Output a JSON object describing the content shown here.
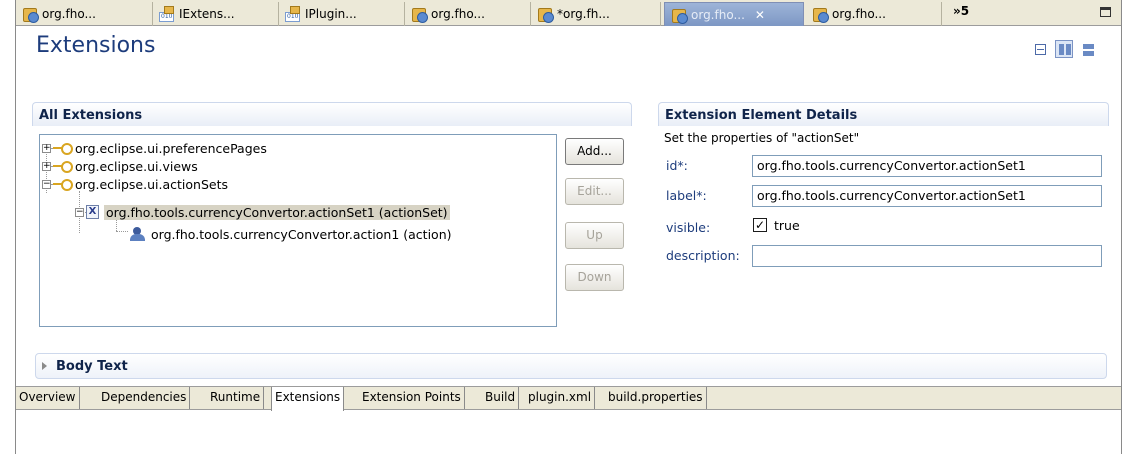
{
  "editor_tabs": [
    {
      "label": "org.fho...",
      "icon": "plugin-icon",
      "active": false
    },
    {
      "label": "IExtens...",
      "icon": "class-file-icon",
      "active": false
    },
    {
      "label": "IPlugin...",
      "icon": "class-file-icon",
      "active": false
    },
    {
      "label": "org.fho...",
      "icon": "plugin-icon",
      "active": false
    },
    {
      "label": "*org.fh...",
      "icon": "plugin-icon",
      "active": false
    },
    {
      "label": "org.fho...",
      "icon": "plugin-icon",
      "active": true
    },
    {
      "label": "org.fho...",
      "icon": "plugin-icon",
      "active": false
    }
  ],
  "overflow_label": "»5",
  "form": {
    "title": "Extensions"
  },
  "all_extensions": {
    "heading": "All Extensions",
    "tree": [
      {
        "label": "org.eclipse.ui.preferencePages",
        "expander": "+"
      },
      {
        "label": "org.eclipse.ui.views",
        "expander": "+"
      },
      {
        "label": "org.eclipse.ui.actionSets",
        "expander": "−"
      },
      {
        "label": "org.fho.tools.currencyConvertor.actionSet1 (actionSet)",
        "expander": "−",
        "selected": true
      },
      {
        "label": "org.fho.tools.currencyConvertor.action1 (action)"
      }
    ],
    "buttons": {
      "add": "Add...",
      "edit": "Edit...",
      "up": "Up",
      "down": "Down"
    }
  },
  "details": {
    "heading": "Extension Element Details",
    "subtitle": "Set the properties of \"actionSet\"",
    "id_label": "id*:",
    "id_value": "org.fho.tools.currencyConvertor.actionSet1",
    "label_label": "label*:",
    "label_value": "org.fho.tools.currencyConvertor.actionSet1",
    "visible_label": "visible:",
    "visible_checked": true,
    "visible_text": "true",
    "description_label": "description:",
    "description_value": ""
  },
  "body_text": {
    "heading": "Body Text"
  },
  "page_tabs": [
    "Overview",
    "Dependencies",
    "Runtime",
    "Extensions",
    "Extension Points",
    "Build",
    "plugin.xml",
    "build.properties"
  ],
  "active_page_tab": "Extensions"
}
